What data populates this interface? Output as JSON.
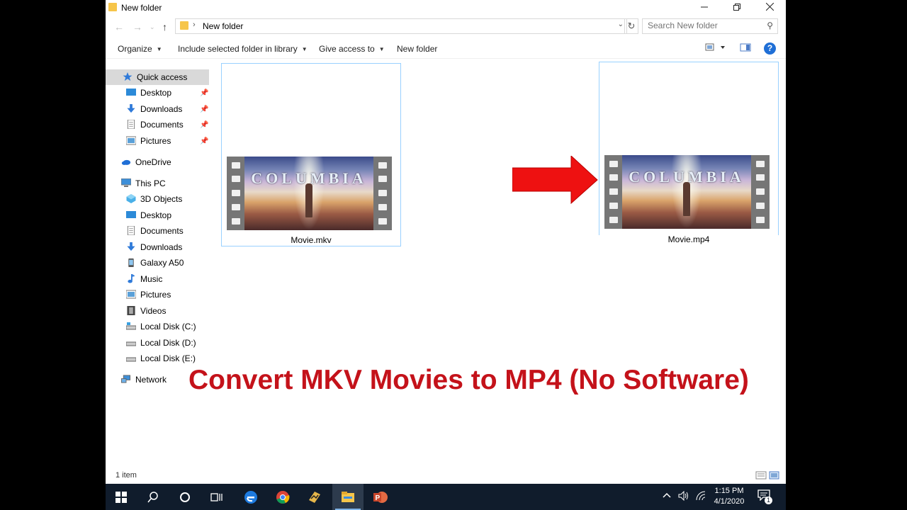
{
  "window": {
    "title": "New folder",
    "controls": [
      "minimize",
      "restore",
      "close"
    ]
  },
  "address_bar": {
    "breadcrumb": "New folder",
    "search_placeholder": "Search New folder"
  },
  "command_bar": {
    "items": [
      "Organize",
      "Include selected folder in library",
      "Give access to",
      "New folder"
    ]
  },
  "sidebar": {
    "quick_access": "Quick access",
    "quick_items": [
      {
        "label": "Desktop",
        "icon": "desktop-icon"
      },
      {
        "label": "Downloads",
        "icon": "download-icon"
      },
      {
        "label": "Documents",
        "icon": "document-icon"
      },
      {
        "label": "Pictures",
        "icon": "picture-icon"
      }
    ],
    "onedrive": "OneDrive",
    "this_pc": "This PC",
    "pc_items": [
      {
        "label": "3D Objects",
        "icon": "cube-icon"
      },
      {
        "label": "Desktop",
        "icon": "desktop-icon"
      },
      {
        "label": "Documents",
        "icon": "document-icon"
      },
      {
        "label": "Downloads",
        "icon": "download-icon"
      },
      {
        "label": "Galaxy A50",
        "icon": "phone-icon"
      },
      {
        "label": "Music",
        "icon": "music-icon"
      },
      {
        "label": "Pictures",
        "icon": "picture-icon"
      },
      {
        "label": "Videos",
        "icon": "video-icon"
      },
      {
        "label": "Local Disk (C:)",
        "icon": "drive-icon"
      },
      {
        "label": "Local Disk (D:)",
        "icon": "drive-icon"
      },
      {
        "label": "Local Disk (E:)",
        "icon": "drive-icon"
      }
    ],
    "network": "Network"
  },
  "files": [
    {
      "name": "Movie.mkv",
      "thumbnail_text": "COLUMBIA"
    },
    {
      "name": "Movie.mp4",
      "thumbnail_text": "COLUMBIA"
    }
  ],
  "overlay": {
    "headline": "Convert MKV Movies to MP4 (No Software)",
    "headline_color": "#c4121a",
    "arrow_color": "#ee1111"
  },
  "status_bar": {
    "item_count": "1 item"
  },
  "taskbar": {
    "apps": [
      "start",
      "search",
      "cortana",
      "task-view",
      "edge",
      "chrome",
      "winamp",
      "file-explorer",
      "powerpoint"
    ],
    "active_app": "file-explorer",
    "time": "1:15 PM",
    "date": "4/1/2020",
    "notification_count": "1"
  }
}
